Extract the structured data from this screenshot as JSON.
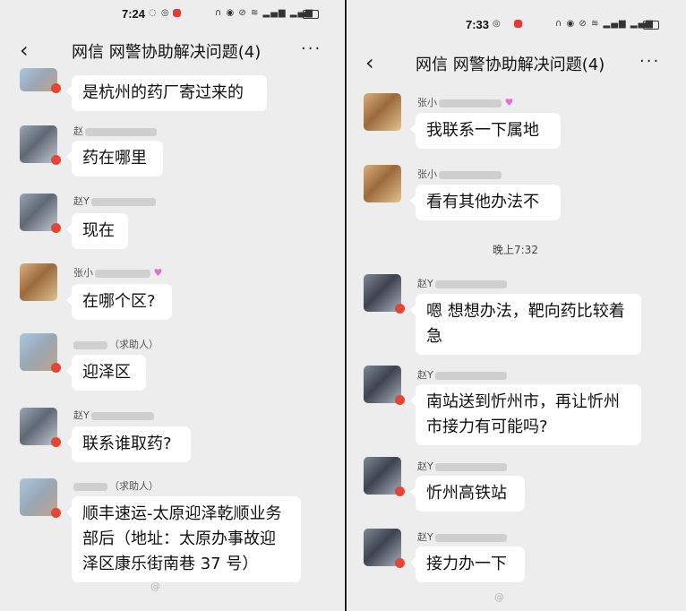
{
  "left": {
    "status_time": "7:24",
    "title": "网信 网警协助解决问题(4)",
    "messages": [
      {
        "sender": "",
        "text": "是杭州的药厂寄过来的"
      },
      {
        "sender": "赵",
        "text": "药在哪里"
      },
      {
        "sender": "赵Y",
        "text": "现在"
      },
      {
        "sender": "张小",
        "text": "在哪个区?"
      },
      {
        "sender": "（求助人）",
        "text": "迎泽区"
      },
      {
        "sender": "赵Y",
        "text": "联系谁取药?"
      },
      {
        "sender": "（求助人）",
        "text": "顺丰速运-太原迎泽乾顺业务部后（地址：太原办事故迎泽区康乐街南巷 37 号）"
      }
    ],
    "watermark": "@"
  },
  "right": {
    "status_time": "7:33",
    "title": "网信 网警协助解决问题(4)",
    "messages": [
      {
        "sender": "张小",
        "text": "我联系一下属地"
      },
      {
        "sender": "张小",
        "text": "看有其他办法不"
      },
      {
        "sender": "赵Y",
        "text": "嗯 想想办法，靶向药比较着急"
      },
      {
        "sender": "赵Y",
        "text": "南站送到忻州市，再让忻州市接力有可能吗?"
      },
      {
        "sender": "赵Y",
        "text": "忻州高铁站"
      },
      {
        "sender": "赵Y",
        "text": "接力办一下"
      }
    ],
    "timestamp": "晚上7:32",
    "watermark": "@"
  },
  "icons": {
    "back": "chevron-left-icon",
    "more": "more-dots-icon"
  },
  "colors": {
    "background": "#ededed",
    "bubble": "#ffffff",
    "badge": "#e64534"
  }
}
